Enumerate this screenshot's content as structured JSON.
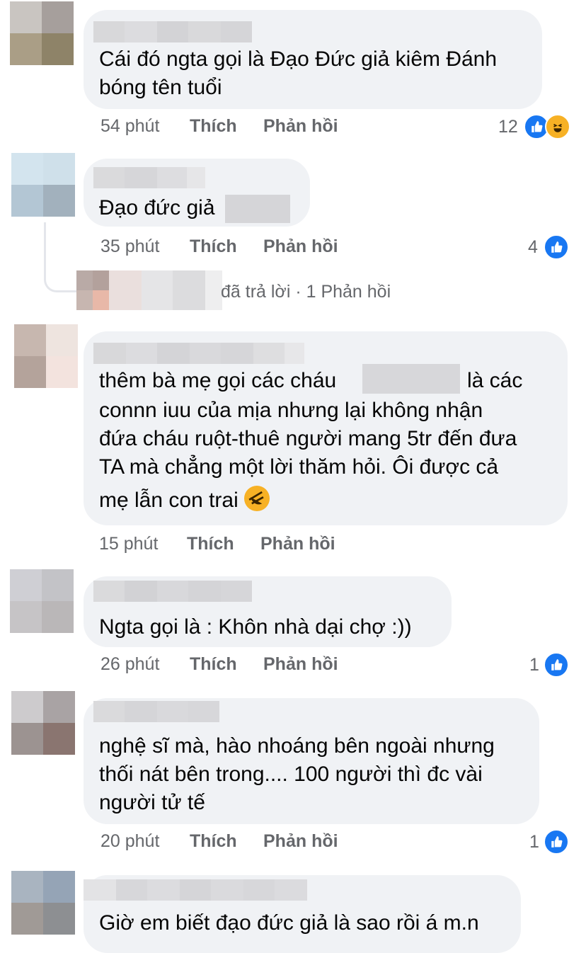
{
  "comments": [
    {
      "text_lines": [
        "Cái đó ngta gọi là Đạo Đức giả kiêm Đánh",
        "bóng tên tuổi"
      ],
      "time": "54 phút",
      "like_label": "Thích",
      "reply_label": "Phản hồi",
      "reaction_count": "12",
      "reactions": [
        "like-icon",
        "haha-icon"
      ]
    },
    {
      "text_lines": [
        "Đạo đức giả"
      ],
      "time": "35 phút",
      "like_label": "Thích",
      "reply_label": "Phản hồi",
      "reaction_count": "4",
      "reactions": [
        "like-icon"
      ]
    },
    {
      "text_lines": [
        "thêm bà mẹ gọi các cháu",
        "là các",
        "connn iuu của mịa nhưng lại không nhận",
        "đứa cháu ruột-thuê người mang 5tr đến đưa",
        "TA mà chẳng một lời thăm hỏi. Ôi được cả",
        "mẹ lẫn con trai"
      ],
      "time": "15 phút",
      "like_label": "Thích",
      "reply_label": "Phản hồi",
      "reactions": []
    },
    {
      "text_lines": [
        "Ngta gọi là : Khôn nhà dại chợ :))"
      ],
      "time": "26 phút",
      "like_label": "Thích",
      "reply_label": "Phản hồi",
      "reaction_count": "1",
      "reactions": [
        "like-icon"
      ]
    },
    {
      "text_lines": [
        "nghệ sĩ mà, hào nhoáng bên ngoài nhưng",
        "thối nát bên trong.... 100 người thì đc vài",
        "người tử tế"
      ],
      "time": "20 phút",
      "like_label": "Thích",
      "reply_label": "Phản hồi",
      "reaction_count": "1",
      "reactions": [
        "like-icon"
      ]
    },
    {
      "text_lines": [
        "Giờ em biết đạo đức giả là sao rồi á m.n"
      ]
    }
  ],
  "reply_summary": {
    "text": "đã trả lời · 1 Phản hồi"
  },
  "colors": {
    "bubble": "#f0f2f5",
    "meta_text": "#65676b",
    "like_blue": "#1877f2",
    "haha_yellow": "#f7b125"
  }
}
